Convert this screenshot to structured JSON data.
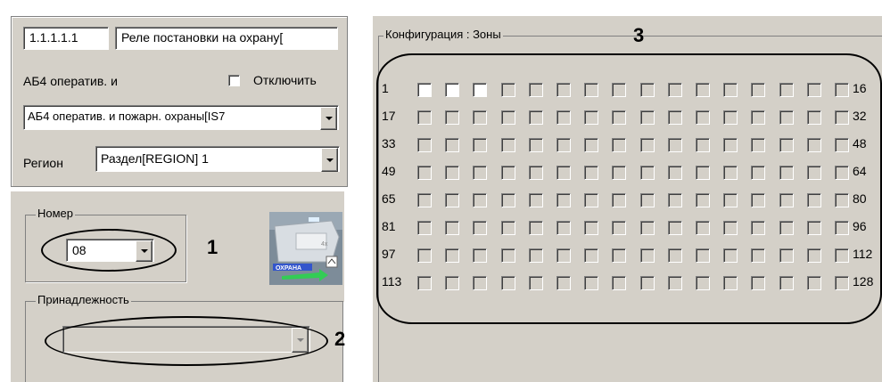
{
  "object_panel": {
    "id_value": "1.1.1.1.1",
    "name_value": "Реле постановки на охрану[",
    "device_label": "АБ4 оператив. и",
    "disable_label": "Отключить",
    "device_select": "АБ4 оператив. и пожарн. охраны[IS7",
    "region_label": "Регион",
    "region_select": "Раздел[REGION] 1"
  },
  "number_group": {
    "title": "Номер",
    "value": "08"
  },
  "affiliation_group": {
    "title": "Принадлежность",
    "value": ""
  },
  "zones_group": {
    "title": "Конфигурация : Зоны",
    "rows": [
      {
        "start": "1",
        "end": "16"
      },
      {
        "start": "17",
        "end": "32"
      },
      {
        "start": "33",
        "end": "48"
      },
      {
        "start": "49",
        "end": "64"
      },
      {
        "start": "65",
        "end": "80"
      },
      {
        "start": "81",
        "end": "96"
      },
      {
        "start": "97",
        "end": "112"
      },
      {
        "start": "113",
        "end": "128"
      }
    ],
    "checked_zones": [
      1,
      2,
      3
    ]
  },
  "callouts": {
    "c1": "1",
    "c2": "2",
    "c3": "3"
  },
  "icons": {
    "device_image": "relay-device-image",
    "device_image_text": "ОХРАНА"
  }
}
